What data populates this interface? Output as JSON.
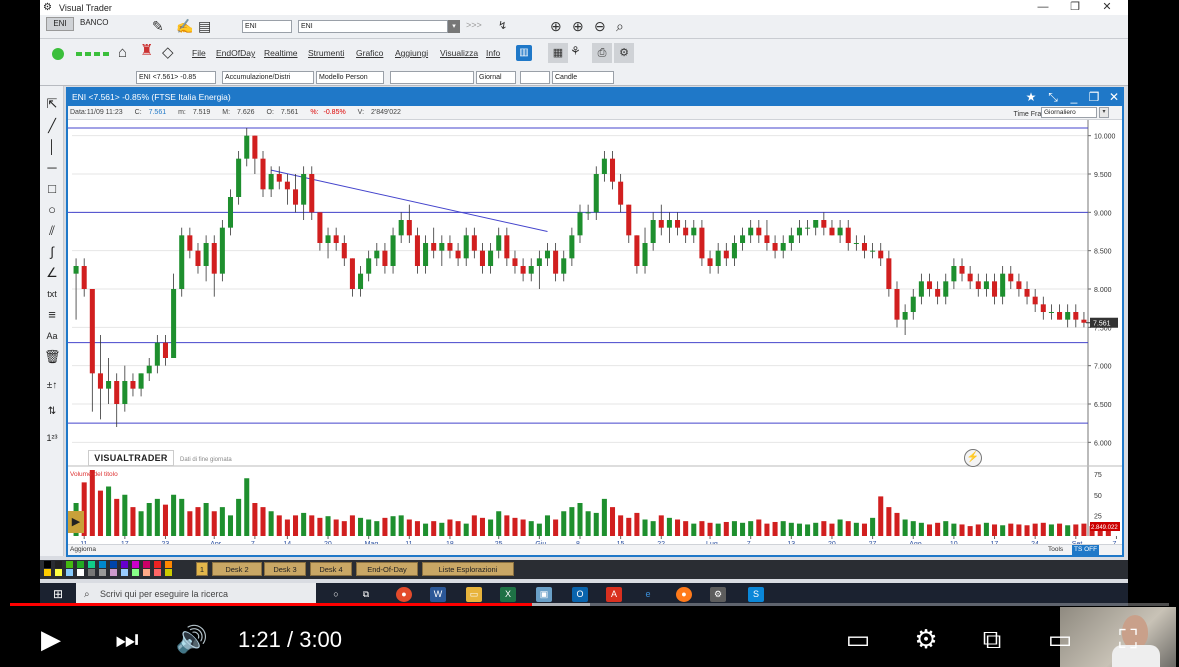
{
  "window": {
    "title": "Visual Trader",
    "minimize": "—",
    "maximize": "❐",
    "close": "✕"
  },
  "toolbar1": {
    "tab_eni": "ENI",
    "tab_banco": "BANCO",
    "symbol_input": "ENI",
    "symbol_select": "ENI",
    "arrows": ">>>"
  },
  "menu": {
    "items": [
      "File",
      "EndOfDay",
      "Realtime",
      "Strumenti",
      "Grafico",
      "Aggiungi",
      "Visualizza",
      "Info"
    ]
  },
  "toolbar3": {
    "instrument": "ENI <7.561> -0.85",
    "indicator": "Accumulazione/Distri",
    "model": "Modello Person",
    "period": "Giornal",
    "chart_type": "Candle"
  },
  "chart_window": {
    "title": "ENI <7.561> -0.85%  (FTSE Italia Energia)",
    "info": {
      "date_label": "Data:",
      "date": "11/09 11:23",
      "close_label": "C:",
      "close": "7.561",
      "min_label": "m:",
      "min": "7.519",
      "max_label": "M:",
      "max": "7.626",
      "open_label": "O:",
      "open": "7.561",
      "pct_label": "%:",
      "pct": "-0.85%",
      "vol_label": "V:",
      "vol": "2'849'022"
    },
    "timeframe_label": "Time Frame",
    "timeframe_value": "Giornaliero",
    "watermark": "VISUALTRADER",
    "watermark_sub": "Dati di fine giornata",
    "volume_label": "Volume del titolo",
    "last_price_tag": "7.561",
    "last_volume_tag": "2.849.022",
    "bottom_left": "Aggiorna",
    "bottom_tools": "Tools",
    "bottom_ts": "TS OFF"
  },
  "desk_tabs": [
    "1",
    "Desk 2",
    "Desk 3",
    "Desk 4",
    "End-Of-Day",
    "Liste Esplorazioni"
  ],
  "taskbar": {
    "search_placeholder": "Scrivi qui per eseguire la ricerca"
  },
  "player": {
    "current_time": "1:21",
    "duration": "3:00",
    "separator": "/",
    "progress": 0.45,
    "loaded": 0.5
  },
  "colors": {
    "accent": "#1f78c8",
    "up": "#1e8f2e",
    "down": "#d11f1f",
    "line": "#4444cc",
    "progress": "#ff0000"
  },
  "chart_data": {
    "type": "candlestick",
    "title": "ENI <7.561> -0.85%  (FTSE Italia Energia)",
    "ylim": [
      5.9,
      10.1
    ],
    "y_ticks": [
      "10.000",
      "9.500",
      "9.000",
      "8.500",
      "8.000",
      "7.500",
      "7.000",
      "6.500",
      "6.000"
    ],
    "y_tick_values": [
      10.0,
      9.5,
      9.0,
      8.5,
      8.0,
      7.5,
      7.0,
      6.5,
      6.0
    ],
    "x_ticks": [
      "11",
      "17",
      "23",
      "Apr",
      "7",
      "14",
      "20",
      "Mag",
      "11",
      "18",
      "25",
      "Giu",
      "8",
      "15",
      "22",
      "Lug",
      "7",
      "13",
      "20",
      "27",
      "Ago",
      "10",
      "17",
      "24",
      "Set",
      "7"
    ],
    "x_tick_index": [
      1,
      6,
      11,
      17,
      22,
      26,
      31,
      36,
      41,
      46,
      52,
      57,
      62,
      67,
      72,
      78,
      83,
      88,
      93,
      98,
      103,
      108,
      113,
      118,
      123,
      128
    ],
    "horizontal_levels": [
      10.1,
      9.0,
      7.3,
      6.25
    ],
    "trendline": {
      "from_index": 24,
      "from_value": 9.55,
      "to_index": 58,
      "to_value": 8.75
    },
    "volume_ylim": [
      0,
      80
    ],
    "volume_ticks": [
      "75",
      "50",
      "25"
    ],
    "volume_tick_values": [
      75,
      50,
      25
    ],
    "ohlc": [
      [
        8.2,
        8.4,
        7.6,
        8.3
      ],
      [
        8.3,
        8.4,
        7.9,
        8.0
      ],
      [
        8.0,
        8.0,
        6.4,
        6.9
      ],
      [
        6.9,
        7.4,
        6.3,
        6.7
      ],
      [
        6.7,
        7.1,
        6.5,
        6.8
      ],
      [
        6.8,
        6.9,
        6.2,
        6.5
      ],
      [
        6.5,
        7.0,
        6.4,
        6.8
      ],
      [
        6.8,
        6.9,
        6.6,
        6.7
      ],
      [
        6.7,
        6.9,
        6.6,
        6.9
      ],
      [
        6.9,
        7.1,
        6.8,
        7.0
      ],
      [
        7.0,
        7.4,
        6.9,
        7.3
      ],
      [
        7.3,
        7.4,
        7.0,
        7.1
      ],
      [
        7.1,
        8.2,
        7.1,
        8.0
      ],
      [
        8.0,
        8.8,
        7.9,
        8.7
      ],
      [
        8.7,
        8.8,
        8.4,
        8.5
      ],
      [
        8.5,
        8.6,
        8.2,
        8.3
      ],
      [
        8.3,
        8.7,
        8.1,
        8.6
      ],
      [
        8.6,
        8.7,
        7.9,
        8.2
      ],
      [
        8.2,
        8.9,
        8.1,
        8.8
      ],
      [
        8.8,
        9.3,
        8.7,
        9.2
      ],
      [
        9.2,
        9.8,
        9.1,
        9.7
      ],
      [
        9.7,
        10.1,
        9.6,
        10.0
      ],
      [
        10.0,
        10.0,
        9.5,
        9.7
      ],
      [
        9.7,
        9.8,
        9.2,
        9.3
      ],
      [
        9.3,
        9.6,
        9.2,
        9.5
      ],
      [
        9.5,
        9.6,
        9.3,
        9.4
      ],
      [
        9.4,
        9.5,
        9.1,
        9.3
      ],
      [
        9.3,
        9.5,
        9.0,
        9.1
      ],
      [
        9.1,
        9.6,
        8.9,
        9.5
      ],
      [
        9.5,
        9.6,
        8.9,
        9.0
      ],
      [
        9.0,
        9.0,
        8.5,
        8.6
      ],
      [
        8.6,
        8.8,
        8.4,
        8.7
      ],
      [
        8.7,
        8.8,
        8.5,
        8.6
      ],
      [
        8.6,
        8.7,
        8.3,
        8.4
      ],
      [
        8.4,
        8.4,
        7.9,
        8.0
      ],
      [
        8.0,
        8.3,
        7.9,
        8.2
      ],
      [
        8.2,
        8.5,
        8.1,
        8.4
      ],
      [
        8.4,
        8.6,
        8.3,
        8.5
      ],
      [
        8.5,
        8.6,
        8.2,
        8.3
      ],
      [
        8.3,
        8.8,
        8.2,
        8.7
      ],
      [
        8.7,
        9.0,
        8.6,
        8.9
      ],
      [
        8.9,
        9.1,
        8.6,
        8.7
      ],
      [
        8.7,
        8.8,
        8.2,
        8.3
      ],
      [
        8.3,
        8.7,
        8.2,
        8.6
      ],
      [
        8.6,
        8.8,
        8.4,
        8.5
      ],
      [
        8.5,
        8.7,
        8.3,
        8.6
      ],
      [
        8.6,
        8.7,
        8.4,
        8.5
      ],
      [
        8.5,
        8.6,
        8.3,
        8.4
      ],
      [
        8.4,
        8.8,
        8.3,
        8.7
      ],
      [
        8.7,
        8.8,
        8.4,
        8.5
      ],
      [
        8.5,
        8.6,
        8.2,
        8.3
      ],
      [
        8.3,
        8.6,
        8.2,
        8.5
      ],
      [
        8.5,
        8.8,
        8.4,
        8.7
      ],
      [
        8.7,
        8.8,
        8.3,
        8.4
      ],
      [
        8.4,
        8.5,
        8.2,
        8.3
      ],
      [
        8.3,
        8.4,
        8.1,
        8.2
      ],
      [
        8.2,
        8.4,
        8.1,
        8.3
      ],
      [
        8.3,
        8.5,
        8.0,
        8.4
      ],
      [
        8.4,
        8.6,
        8.3,
        8.5
      ],
      [
        8.5,
        8.6,
        8.1,
        8.2
      ],
      [
        8.2,
        8.5,
        8.1,
        8.4
      ],
      [
        8.4,
        8.8,
        8.3,
        8.7
      ],
      [
        8.7,
        9.1,
        8.6,
        9.0
      ],
      [
        9.0,
        9.1,
        8.9,
        9.0
      ],
      [
        9.0,
        9.6,
        8.9,
        9.5
      ],
      [
        9.5,
        9.8,
        9.4,
        9.7
      ],
      [
        9.7,
        9.8,
        9.3,
        9.4
      ],
      [
        9.4,
        9.5,
        9.0,
        9.1
      ],
      [
        9.1,
        9.1,
        8.6,
        8.7
      ],
      [
        8.7,
        8.7,
        8.2,
        8.3
      ],
      [
        8.3,
        8.8,
        8.2,
        8.6
      ],
      [
        8.6,
        9.0,
        8.5,
        8.9
      ],
      [
        8.9,
        9.1,
        8.7,
        8.8
      ],
      [
        8.8,
        9.0,
        8.6,
        8.9
      ],
      [
        8.9,
        9.0,
        8.7,
        8.8
      ],
      [
        8.8,
        8.9,
        8.6,
        8.7
      ],
      [
        8.7,
        8.9,
        8.6,
        8.8
      ],
      [
        8.8,
        8.9,
        8.3,
        8.4
      ],
      [
        8.4,
        8.5,
        8.2,
        8.3
      ],
      [
        8.3,
        8.6,
        8.2,
        8.5
      ],
      [
        8.5,
        8.6,
        8.3,
        8.4
      ],
      [
        8.4,
        8.7,
        8.3,
        8.6
      ],
      [
        8.6,
        8.8,
        8.5,
        8.7
      ],
      [
        8.7,
        8.9,
        8.6,
        8.8
      ],
      [
        8.8,
        8.9,
        8.6,
        8.7
      ],
      [
        8.7,
        8.9,
        8.5,
        8.6
      ],
      [
        8.6,
        8.7,
        8.4,
        8.5
      ],
      [
        8.5,
        8.7,
        8.4,
        8.6
      ],
      [
        8.6,
        8.8,
        8.5,
        8.7
      ],
      [
        8.7,
        8.9,
        8.6,
        8.8
      ],
      [
        8.8,
        8.9,
        8.7,
        8.8
      ],
      [
        8.8,
        8.9,
        8.7,
        8.9
      ],
      [
        8.9,
        9.0,
        8.7,
        8.8
      ],
      [
        8.8,
        8.9,
        8.7,
        8.7
      ],
      [
        8.7,
        8.9,
        8.6,
        8.8
      ],
      [
        8.8,
        8.9,
        8.5,
        8.6
      ],
      [
        8.6,
        8.7,
        8.5,
        8.6
      ],
      [
        8.6,
        8.7,
        8.4,
        8.5
      ],
      [
        8.5,
        8.6,
        8.4,
        8.5
      ],
      [
        8.5,
        8.6,
        8.3,
        8.4
      ],
      [
        8.4,
        8.5,
        7.9,
        8.0
      ],
      [
        8.0,
        8.1,
        7.5,
        7.6
      ],
      [
        7.6,
        7.8,
        7.4,
        7.7
      ],
      [
        7.7,
        8.0,
        7.6,
        7.9
      ],
      [
        7.9,
        8.2,
        7.8,
        8.1
      ],
      [
        8.1,
        8.2,
        7.9,
        8.0
      ],
      [
        8.0,
        8.1,
        7.8,
        7.9
      ],
      [
        7.9,
        8.2,
        7.8,
        8.1
      ],
      [
        8.1,
        8.4,
        8.0,
        8.3
      ],
      [
        8.3,
        8.4,
        8.1,
        8.2
      ],
      [
        8.2,
        8.3,
        8.0,
        8.1
      ],
      [
        8.1,
        8.2,
        7.9,
        8.0
      ],
      [
        8.0,
        8.2,
        7.9,
        8.1
      ],
      [
        8.1,
        8.2,
        7.8,
        7.9
      ],
      [
        7.9,
        8.3,
        7.8,
        8.2
      ],
      [
        8.2,
        8.3,
        8.0,
        8.1
      ],
      [
        8.1,
        8.2,
        7.9,
        8.0
      ],
      [
        8.0,
        8.1,
        7.8,
        7.9
      ],
      [
        7.9,
        8.0,
        7.7,
        7.8
      ],
      [
        7.8,
        7.9,
        7.6,
        7.7
      ],
      [
        7.7,
        7.8,
        7.6,
        7.7
      ],
      [
        7.7,
        7.8,
        7.6,
        7.6
      ],
      [
        7.6,
        7.8,
        7.5,
        7.7
      ],
      [
        7.7,
        7.8,
        7.5,
        7.6
      ],
      [
        7.6,
        7.7,
        7.5,
        7.56
      ]
    ],
    "volume": [
      40,
      65,
      80,
      55,
      60,
      45,
      50,
      35,
      30,
      40,
      45,
      38,
      50,
      45,
      30,
      35,
      40,
      30,
      35,
      25,
      45,
      70,
      40,
      35,
      30,
      25,
      20,
      25,
      28,
      25,
      22,
      24,
      20,
      18,
      25,
      22,
      20,
      18,
      22,
      24,
      25,
      20,
      18,
      15,
      18,
      16,
      20,
      18,
      15,
      25,
      22,
      20,
      30,
      25,
      22,
      20,
      18,
      15,
      25,
      20,
      30,
      35,
      40,
      30,
      28,
      45,
      35,
      25,
      22,
      28,
      20,
      18,
      25,
      22,
      20,
      18,
      15,
      18,
      16,
      15,
      17,
      18,
      16,
      18,
      20,
      15,
      17,
      18,
      16,
      15,
      14,
      16,
      18,
      15,
      20,
      18,
      16,
      15,
      22,
      48,
      35,
      28,
      20,
      18,
      16,
      14,
      16,
      18,
      15,
      14,
      12,
      14,
      16,
      14,
      13,
      15,
      14,
      13,
      15,
      16,
      14,
      15,
      13,
      14,
      15,
      12,
      10,
      8
    ]
  }
}
